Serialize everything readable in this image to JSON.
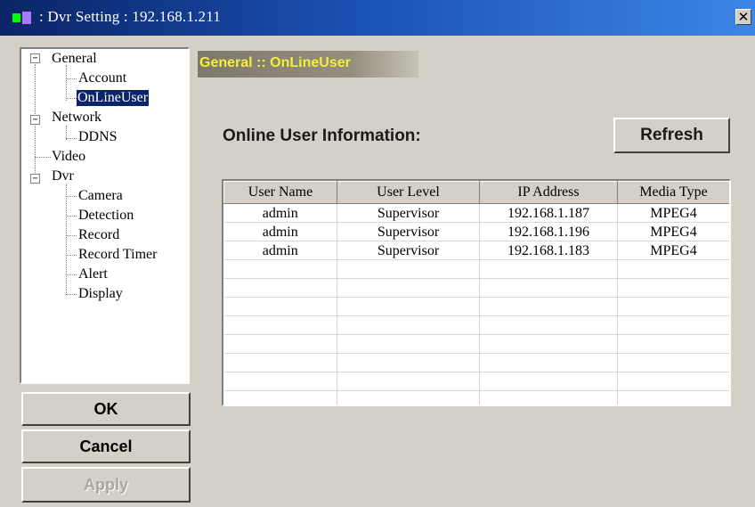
{
  "window": {
    "title": ": Dvr Setting : 192.168.1.211",
    "close_glyph": "✕"
  },
  "tree": {
    "expander_glyph": "−",
    "items": [
      {
        "label": "General",
        "level": 0,
        "expander": true
      },
      {
        "label": "Account",
        "level": 1
      },
      {
        "label": "OnLineUser",
        "level": 1,
        "selected": true
      },
      {
        "label": "Network",
        "level": 0,
        "expander": true
      },
      {
        "label": "DDNS",
        "level": 1
      },
      {
        "label": "Video",
        "level": 0
      },
      {
        "label": "Dvr",
        "level": 0,
        "expander": true
      },
      {
        "label": "Camera",
        "level": 1
      },
      {
        "label": "Detection",
        "level": 1
      },
      {
        "label": "Record",
        "level": 1
      },
      {
        "label": "Record Timer",
        "level": 1
      },
      {
        "label": "Alert",
        "level": 1
      },
      {
        "label": "Display",
        "level": 1
      }
    ]
  },
  "buttons": {
    "ok": "OK",
    "cancel": "Cancel",
    "apply": "Apply",
    "refresh": "Refresh"
  },
  "panel": {
    "header": "General :: OnLineUser",
    "info_label": "Online User Information:"
  },
  "table": {
    "columns": [
      "User Name",
      "User Level",
      "IP Address",
      "Media Type"
    ],
    "rows": [
      [
        "admin",
        "Supervisor",
        "192.168.1.187",
        "MPEG4"
      ],
      [
        "admin",
        "Supervisor",
        "192.168.1.196",
        "MPEG4"
      ],
      [
        "admin",
        "Supervisor",
        "192.168.1.183",
        "MPEG4"
      ]
    ]
  },
  "colors": {
    "accent_title": "#0a246a",
    "header_text": "#f4ee3a",
    "window_bg": "#d4d0c8"
  }
}
